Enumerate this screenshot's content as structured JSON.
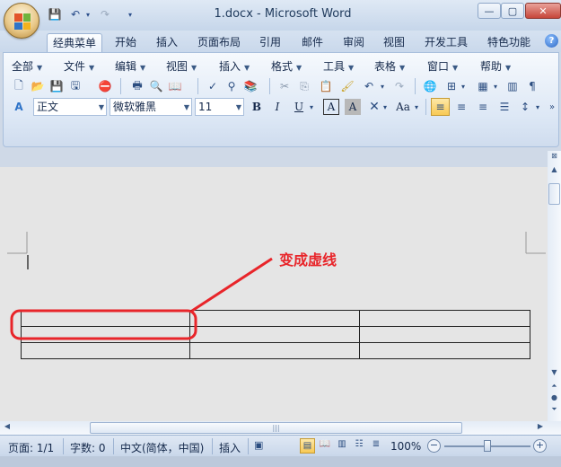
{
  "window": {
    "title": "1.docx - Microsoft Word",
    "minimize_symbol": "—",
    "maximize_symbol": "▢",
    "close_symbol": "✕"
  },
  "tabs": [
    "经典菜单",
    "开始",
    "插入",
    "页面布局",
    "引用",
    "邮件",
    "审阅",
    "视图",
    "开发工具",
    "特色功能"
  ],
  "active_tab": 0,
  "menu": [
    "全部",
    "文件",
    "编辑",
    "视图",
    "插入",
    "格式",
    "工具",
    "表格",
    "窗口",
    "帮助"
  ],
  "formatting": {
    "style": "正文",
    "font": "微软雅黑",
    "size": "11",
    "bold": "B",
    "italic": "I",
    "underline": "U",
    "char_border": "A",
    "char_shading": "A",
    "change_case": "Aa"
  },
  "annotation": {
    "text": "变成虚线",
    "color": "#e8252a"
  },
  "document": {
    "table_rows": 3,
    "table_cols": 3
  },
  "status": {
    "page": "页面: 1/1",
    "words": "字数: 0",
    "language": "中文(简体，中国)",
    "mode": "插入",
    "zoom": "100%",
    "zoom_level": 1.0
  }
}
